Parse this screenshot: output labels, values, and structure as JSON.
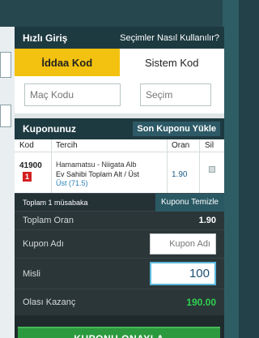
{
  "quick_entry": {
    "title": "Hızlı Giriş",
    "help_link": "Seçimler Nasıl Kullanılır?",
    "tabs": [
      "İddaa Kod",
      "Sistem Kod"
    ],
    "active_tab": 0,
    "code_placeholder": "Maç Kodu",
    "selection_placeholder": "Seçim"
  },
  "coupon": {
    "title": "Kuponunuz",
    "load_last_button": "Son Kuponu Yükle",
    "columns": [
      "Kod",
      "Tercih",
      "Oran",
      "Sil"
    ],
    "rows": [
      {
        "code": "41900",
        "mbs": "1",
        "match": "Hamamatsu - Niigata Alb",
        "pick": "Ev Sahibi Toplam Alt / Üst",
        "selection": "Üst (71.5)",
        "odds": "1.90"
      }
    ],
    "summary": "Toplam 1 müsabaka",
    "clear_button": "Kuponu Temizle",
    "total_odds_label": "Toplam Oran",
    "total_odds_value": "1.90",
    "coupon_name_label": "Kupon Adı",
    "coupon_name_placeholder": "Kupon Adı",
    "multiplier_label": "Misli",
    "multiplier_value": "100",
    "potential_win_label": "Olası Kazanç",
    "potential_win_value": "190.00",
    "confirm_button": "KUPONU ONAYLA"
  },
  "colors": {
    "accent_yellow": "#f3c210",
    "header_teal": "#1e3a41",
    "win_green": "#2fd050",
    "confirm_green": "#2b9a3e",
    "mbs_red": "#d42020"
  }
}
